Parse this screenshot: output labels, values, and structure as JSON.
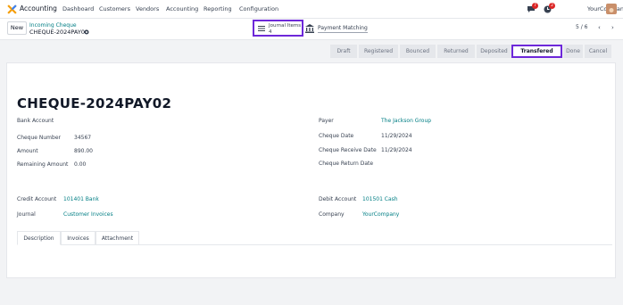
{
  "topnav": {
    "app_name": "Accounting",
    "menu": [
      "Dashboard",
      "Customers",
      "Vendors",
      "Accounting",
      "Reporting",
      "Configuration"
    ],
    "messages_count": "7",
    "activity_count": "2",
    "company": "YourCompany"
  },
  "control": {
    "new_label": "New",
    "breadcrumb_parent": "Incoming Cheque",
    "breadcrumb_current": "CHEQUE-2024PAY02",
    "journal_items_label": "Journal Items",
    "journal_items_count": "4",
    "payment_matching_label": "Payment Matching",
    "pager": "5 / 6"
  },
  "status": {
    "stages": [
      "Draft",
      "Registered",
      "Bounced",
      "Returned",
      "Deposited",
      "Transfered",
      "Done",
      "Cancel"
    ],
    "active": "Transfered"
  },
  "record": {
    "title": "CHEQUE-2024PAY02",
    "left": [
      {
        "label": "Bank Account",
        "value": ""
      },
      {
        "label": "Cheque Number",
        "value": "34567"
      },
      {
        "label": "Amount",
        "value": "890.00"
      },
      {
        "label": "Remaining Amount",
        "value": "0.00"
      }
    ],
    "right": [
      {
        "label": "Payer",
        "value": "The Jackson Group"
      },
      {
        "label": "Cheque Date",
        "value": "11/29/2024"
      },
      {
        "label": "Cheque Receive Date",
        "value": "11/29/2024"
      },
      {
        "label": "Cheque Return Date",
        "value": ""
      }
    ],
    "credit_account_label": "Credit Account",
    "credit_account": "101401 Bank",
    "journal_label": "Journal",
    "journal": "Customer Invoices",
    "debit_account_label": "Debit Account",
    "debit_account": "101501 Cash",
    "company_label": "Company",
    "company": "YourCompany"
  },
  "tabs": [
    "Description",
    "Invoices",
    "Attachment"
  ],
  "colors": {
    "accent": "#6d28d9",
    "link": "#017e84"
  }
}
